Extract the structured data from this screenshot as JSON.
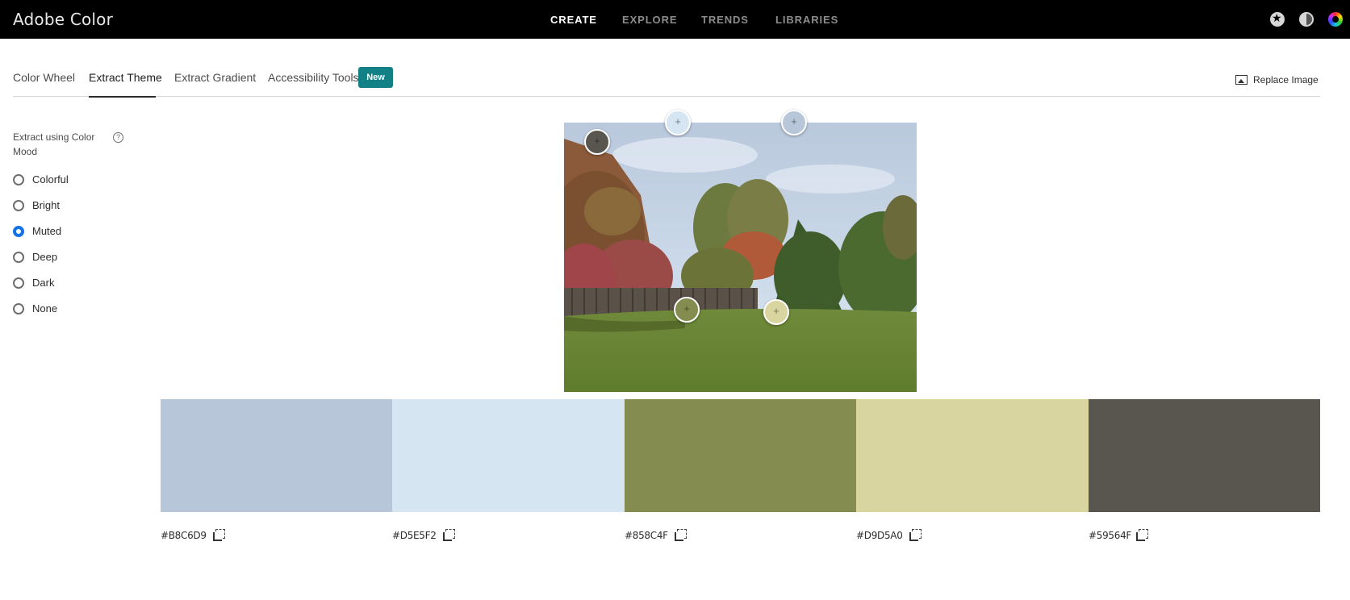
{
  "app": {
    "title": "Adobe Color"
  },
  "nav": {
    "items": [
      {
        "label": "CREATE",
        "active": true
      },
      {
        "label": "EXPLORE",
        "active": false
      },
      {
        "label": "TRENDS",
        "active": false
      },
      {
        "label": "LIBRARIES",
        "active": false
      }
    ]
  },
  "top_icons": [
    "star-icon",
    "contrast-icon",
    "color-wheel-icon"
  ],
  "tabs": [
    {
      "label": "Color Wheel",
      "active": false
    },
    {
      "label": "Extract Theme",
      "active": true
    },
    {
      "label": "Extract Gradient",
      "active": false
    },
    {
      "label": "Accessibility Tools",
      "active": false
    }
  ],
  "badge": {
    "label": "New",
    "color": "#128185"
  },
  "replace_image": {
    "label": "Replace Image",
    "icon": "image-icon"
  },
  "mood": {
    "title": "Extract using Color Mood",
    "help_icon": "help-icon",
    "options": [
      {
        "label": "Colorful",
        "checked": false
      },
      {
        "label": "Bright",
        "checked": false
      },
      {
        "label": "Muted",
        "checked": true
      },
      {
        "label": "Deep",
        "checked": false
      },
      {
        "label": "Dark",
        "checked": false
      },
      {
        "label": "None",
        "checked": false
      }
    ]
  },
  "accent_color": "#1473e6",
  "samplers": [
    {
      "name": "sampler-dark",
      "color": "#59564F"
    },
    {
      "name": "sampler-light-blue",
      "color": "#D5E5F2"
    },
    {
      "name": "sampler-blue-gray",
      "color": "#B8C6D9"
    },
    {
      "name": "sampler-olive",
      "color": "#858C4F"
    },
    {
      "name": "sampler-khaki",
      "color": "#D9D5A0"
    }
  ],
  "swatches": [
    {
      "hex": "#B8C6D9",
      "color": "#B8C6D9"
    },
    {
      "hex": "#D5E5F2",
      "color": "#D5E5F2"
    },
    {
      "hex": "#858C4F",
      "color": "#858C4F"
    },
    {
      "hex": "#D9D5A0",
      "color": "#D9D5A0"
    },
    {
      "hex": "#59564F",
      "color": "#59564F"
    }
  ]
}
